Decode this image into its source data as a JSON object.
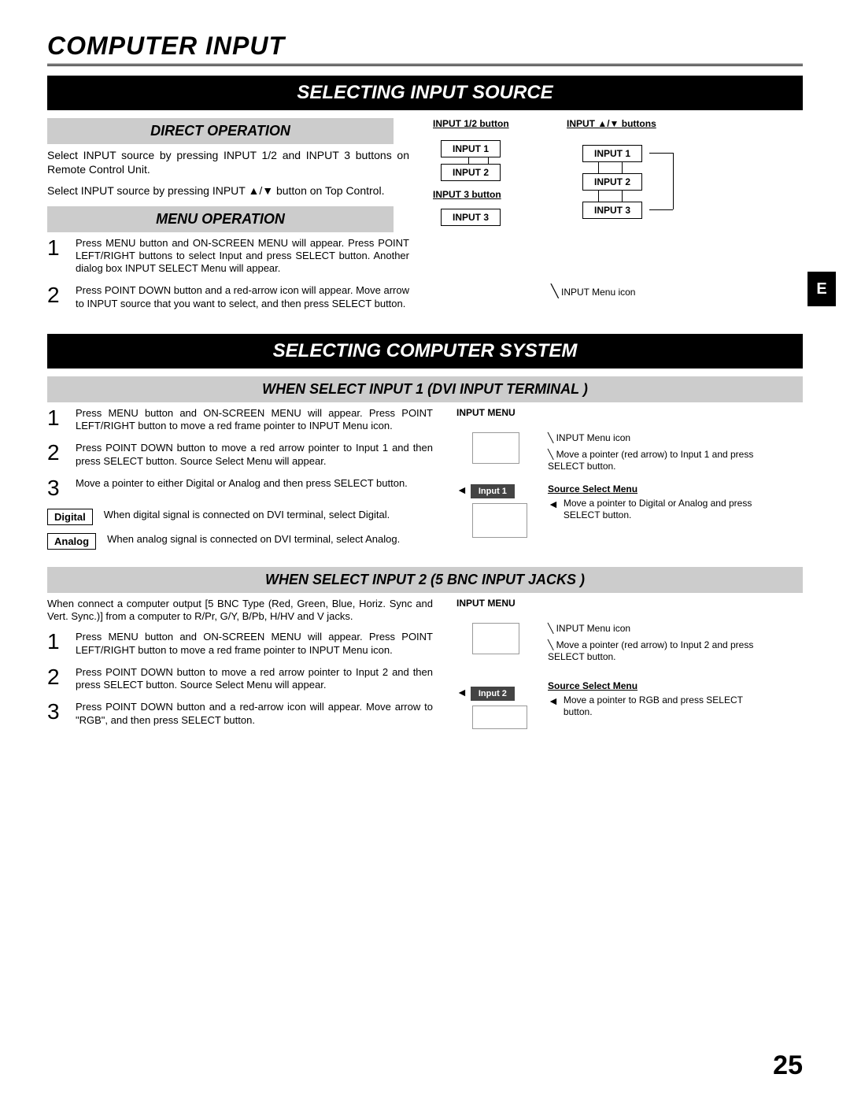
{
  "title": "COMPUTER INPUT",
  "sec1": {
    "bar": "SELECTING INPUT SOURCE",
    "direct_heading": "DIRECT OPERATION",
    "direct_p1": "Select INPUT source by pressing INPUT 1/2 and INPUT 3 buttons on Remote Control Unit.",
    "direct_p2": "Select INPUT source by pressing INPUT ▲/▼ button on Top Control.",
    "menu_heading": "MENU OPERATION",
    "step1": "Press MENU button and ON-SCREEN MENU will appear.  Press POINT LEFT/RIGHT buttons to select Input and press  SELECT button.  Another dialog box INPUT SELECT Menu will appear.",
    "step2": "Press POINT DOWN button and a red-arrow icon will appear. Move arrow to INPUT source that you want to select, and then press SELECT button.",
    "diag_12_label": "INPUT 1/2 button",
    "diag_ud_label": "INPUT ▲/▼  buttons",
    "diag_3_label": "INPUT 3 button",
    "diag_input1": "INPUT 1",
    "diag_input2": "INPUT 2",
    "diag_input3": "INPUT 3",
    "menu_icon_note": "INPUT Menu icon"
  },
  "sec2": {
    "bar": "SELECTING COMPUTER SYSTEM",
    "sub1_heading": "WHEN SELECT  INPUT 1 (DVI INPUT TERMINAL )",
    "s1_step1": "Press MENU button and ON-SCREEN MENU will appear.  Press POINT LEFT/RIGHT button to move a red frame pointer to INPUT Menu icon.",
    "s1_step2": "Press POINT DOWN button to move a red arrow pointer to Input 1 and then press SELECT button.  Source Select Menu will appear.",
    "s1_step3": "Move a pointer to either Digital or Analog and then press SELECT button.",
    "digital_label": "Digital",
    "digital_text": "When digital signal is connected on DVI terminal, select Digital.",
    "analog_label": "Analog",
    "analog_text": "When analog signal is connected on DVI terminal, select Analog.",
    "s1_input_menu": "INPUT MENU",
    "s1_menu_icon": "INPUT Menu icon",
    "s1_move1": "Move a pointer (red arrow) to Input 1 and press SELECT button.",
    "s1_input1_box": "Input 1",
    "s1_source_menu": "Source Select Menu",
    "s1_move2": "Move a pointer to Digital or Analog and press SELECT button.",
    "sub2_heading": "WHEN SELECT INPUT 2 (5 BNC INPUT JACKS )",
    "s2_intro": "When connect a computer output [5 BNC Type (Red, Green, Blue, Horiz. Sync and Vert. Sync.)] from a computer to R/Pr, G/Y, B/Pb, H/HV and V jacks.",
    "s2_step1": "Press MENU button and ON-SCREEN MENU will appear.  Press POINT LEFT/RIGHT button to move a red frame pointer to INPUT Menu icon.",
    "s2_step2": "Press POINT DOWN button to move a red arrow pointer to Input 2 and then press SELECT button.  Source Select Menu will appear.",
    "s2_step3": "Press POINT DOWN button and a red-arrow icon will appear. Move arrow to \"RGB\", and then press SELECT button.",
    "s2_input_menu": "INPUT MENU",
    "s2_menu_icon": "INPUT Menu icon",
    "s2_move1": "Move a pointer (red arrow) to Input 2 and press SELECT button.",
    "s2_input2_box": "Input 2",
    "s2_source_menu": "Source Select Menu",
    "s2_move2": "Move a pointer to RGB and press SELECT button."
  },
  "page": "25",
  "sidebar": "E"
}
